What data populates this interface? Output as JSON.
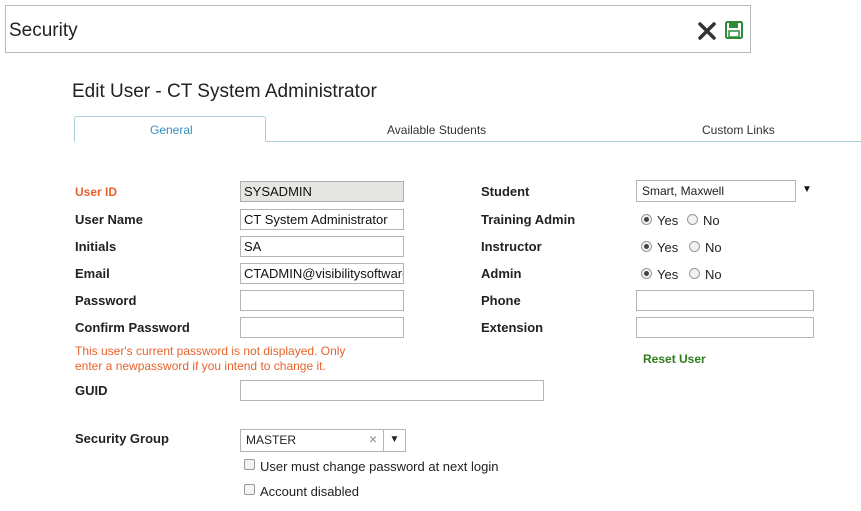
{
  "header": {
    "title": "Security"
  },
  "page": {
    "title": "Edit User - CT System Administrator"
  },
  "tabs": [
    {
      "label": "General",
      "active": true
    },
    {
      "label": "Available Students",
      "active": false
    },
    {
      "label": "Custom Links",
      "active": false
    }
  ],
  "form": {
    "user_id_label": "User ID",
    "user_id_value": "SYSADMIN",
    "user_name_label": "User Name",
    "user_name_value": "CT System Administrator",
    "initials_label": "Initials",
    "initials_value": "SA",
    "email_label": "Email",
    "email_value": "CTADMIN@visibilitysoftware",
    "password_label": "Password",
    "password_value": "",
    "confirm_password_label": "Confirm Password",
    "confirm_password_value": "",
    "password_note_line1": "This user's current password is not displayed. Only",
    "password_note_line2": "enter a newpassword if you intend to change it.",
    "guid_label": "GUID",
    "guid_value": "",
    "security_group_label": "Security Group",
    "security_group_value": "MASTER",
    "clear_glyph": "×",
    "dropdown_glyph": "▼",
    "must_change_label": "User must change password at next login",
    "must_change_checked": false,
    "disabled_label": "Account disabled",
    "disabled_checked": false,
    "student_label": "Student",
    "student_value": "Smart, Maxwell",
    "training_admin_label": "Training Admin",
    "instructor_label": "Instructor",
    "admin_label": "Admin",
    "yes_label": "Yes",
    "no_label": "No",
    "training_admin_selected": "Yes",
    "instructor_selected": "Yes",
    "admin_selected": "Yes",
    "phone_label": "Phone",
    "phone_value": "",
    "extension_label": "Extension",
    "extension_value": "",
    "reset_user_label": "Reset User"
  },
  "colors": {
    "accent_orange": "#e8632a",
    "tab_active": "#3a8fc0",
    "reset_green": "#2e7d1a",
    "save_icon": "#2f8a3a"
  }
}
